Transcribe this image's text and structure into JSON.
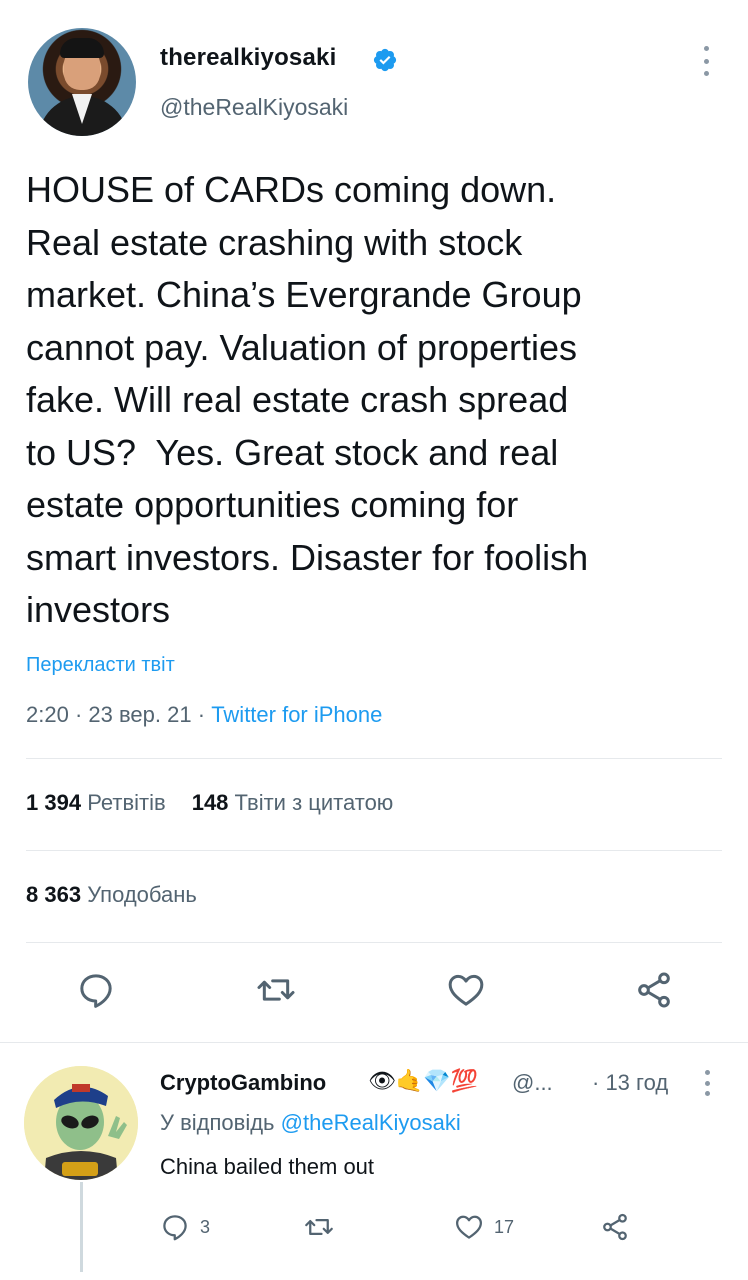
{
  "tweet": {
    "author_name": "therealkiyosaki",
    "author_handle": "@theRealKiyosaki",
    "verified": true,
    "text": "HOUSE of CARDs coming down.\nReal estate crashing with stock\nmarket. China’s Evergrande Group\ncannot pay. Valuation of properties\nfake. Will real estate crash spread\nto US?  Yes. Great stock and real\nestate opportunities coming for\nsmart investors. Disaster for foolish\ninvestors",
    "translate_label": "Перекласти твіт",
    "time": "2:20",
    "date": "23 вер. 21",
    "separator": "·",
    "source": "Twitter for iPhone",
    "retweets_count": "1 394",
    "retweets_label": "Ретвітів",
    "quotes_count": "148",
    "quotes_label": "Твіти з цитатою",
    "likes_count": "8 363",
    "likes_label": "Уподобань"
  },
  "actions": {
    "icons": [
      "reply-icon",
      "retweet-icon",
      "like-icon",
      "share-icon"
    ]
  },
  "reply": {
    "author_name": "CryptoGambino",
    "author_emojis": "👁🤙💎💯",
    "author_handle": "@...",
    "time": "· 13 год",
    "reply_to_prefix": "У відповідь",
    "reply_to_mention": "@theRealKiyosaki",
    "text": "China bailed them out",
    "reply_count": "3",
    "like_count": "17",
    "avatar_badge": "STM"
  },
  "colors": {
    "accent": "#1d9bf0",
    "secondary_text": "#536471",
    "primary_text": "#0f1419",
    "divider": "#e6e9ec"
  }
}
